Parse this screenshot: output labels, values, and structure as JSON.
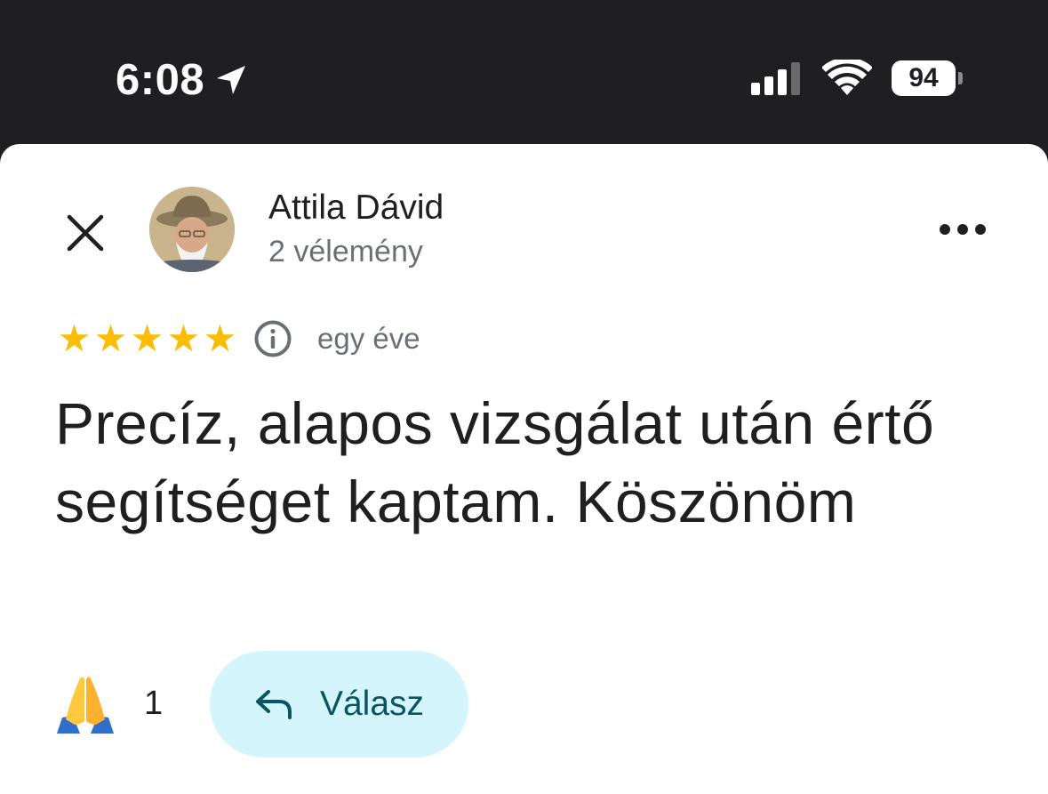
{
  "status_bar": {
    "time": "6:08",
    "battery": "94",
    "icons": [
      "location-arrow-icon",
      "cellular-signal-icon",
      "wifi-icon",
      "battery-icon"
    ]
  },
  "review": {
    "close_icon": "close-icon",
    "reviewer_name": "Attila Dávid",
    "review_count": "2 vélemény",
    "more_icon": "more-horizontal-icon",
    "rating": 5,
    "stars": [
      "★",
      "★",
      "★",
      "★",
      "★"
    ],
    "info_icon": "info-icon",
    "age": "egy éve",
    "text": "Precíz, alapos vizsgálat után értő segítséget kaptam. Köszönöm",
    "reaction_emoji": "folded-hands-emoji",
    "reaction_count": "1",
    "reply_label": "Válasz",
    "reply_icon": "reply-arrow-icon"
  },
  "colors": {
    "status_bar_bg": "#1f1f21",
    "star": "#fbbc04",
    "reply_bg": "#d4f5fc",
    "reply_text": "#0b5563",
    "secondary_text": "#6b6f73"
  }
}
